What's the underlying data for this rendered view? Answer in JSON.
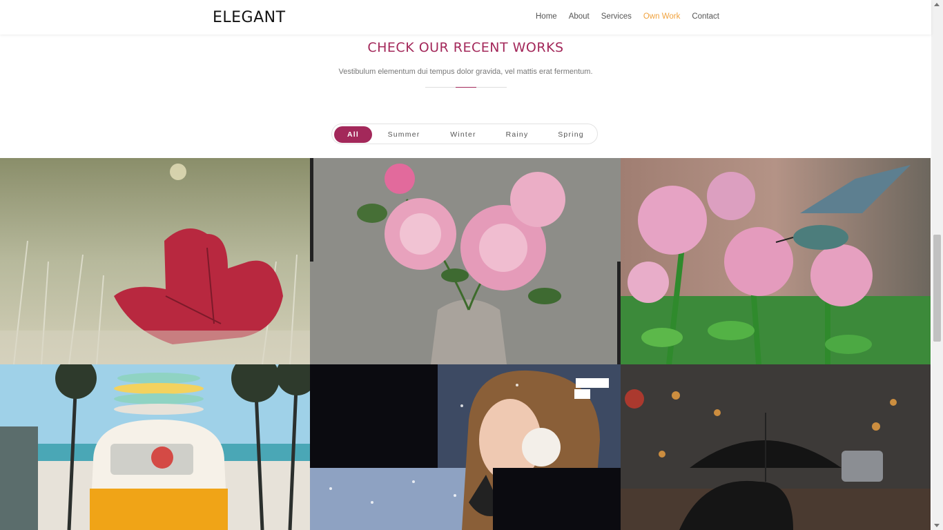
{
  "header": {
    "logo": "ELEGANT",
    "nav": [
      "Home",
      "About",
      "Services",
      "Own Work",
      "Contact"
    ],
    "active_nav": "Own Work"
  },
  "section": {
    "title": "CHECK OUR RECENT WORKS",
    "subtitle": "Vestibulum elementum dui tempus dolor gravida, vel mattis erat fermentum."
  },
  "filters": {
    "items": [
      "All",
      "Summer",
      "Winter",
      "Rainy",
      "Spring"
    ],
    "active": "All"
  },
  "colors": {
    "accent": "#a3285a",
    "nav_active": "#f0a23e"
  }
}
